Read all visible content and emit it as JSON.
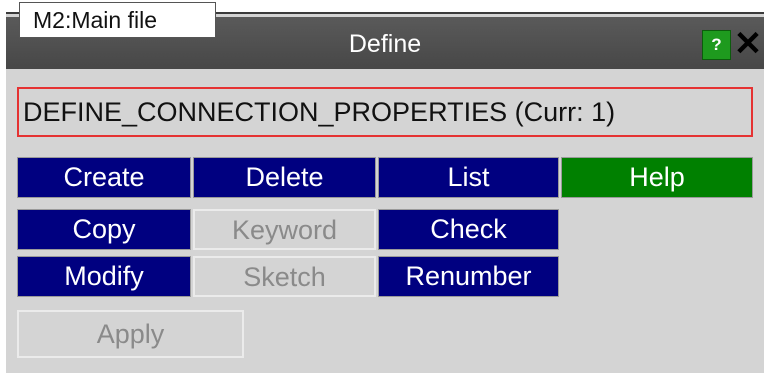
{
  "tab": {
    "label": "M2:Main file"
  },
  "window": {
    "title": "Define",
    "help_icon": "?",
    "close_icon": "✕"
  },
  "keyword_display": "DEFINE_CONNECTION_PROPERTIES (Curr: 1)",
  "buttons": {
    "create": "Create",
    "delete": "Delete",
    "list": "List",
    "help": "Help",
    "copy": "Copy",
    "keyword": "Keyword",
    "check": "Check",
    "modify": "Modify",
    "sketch": "Sketch",
    "renumber": "Renumber",
    "apply": "Apply"
  },
  "colors": {
    "button_blue": "#000080",
    "button_green": "#008000",
    "panel_gray": "#d4d4d4",
    "title_bar": "#4f4f4f",
    "highlight_border": "#e53232"
  }
}
